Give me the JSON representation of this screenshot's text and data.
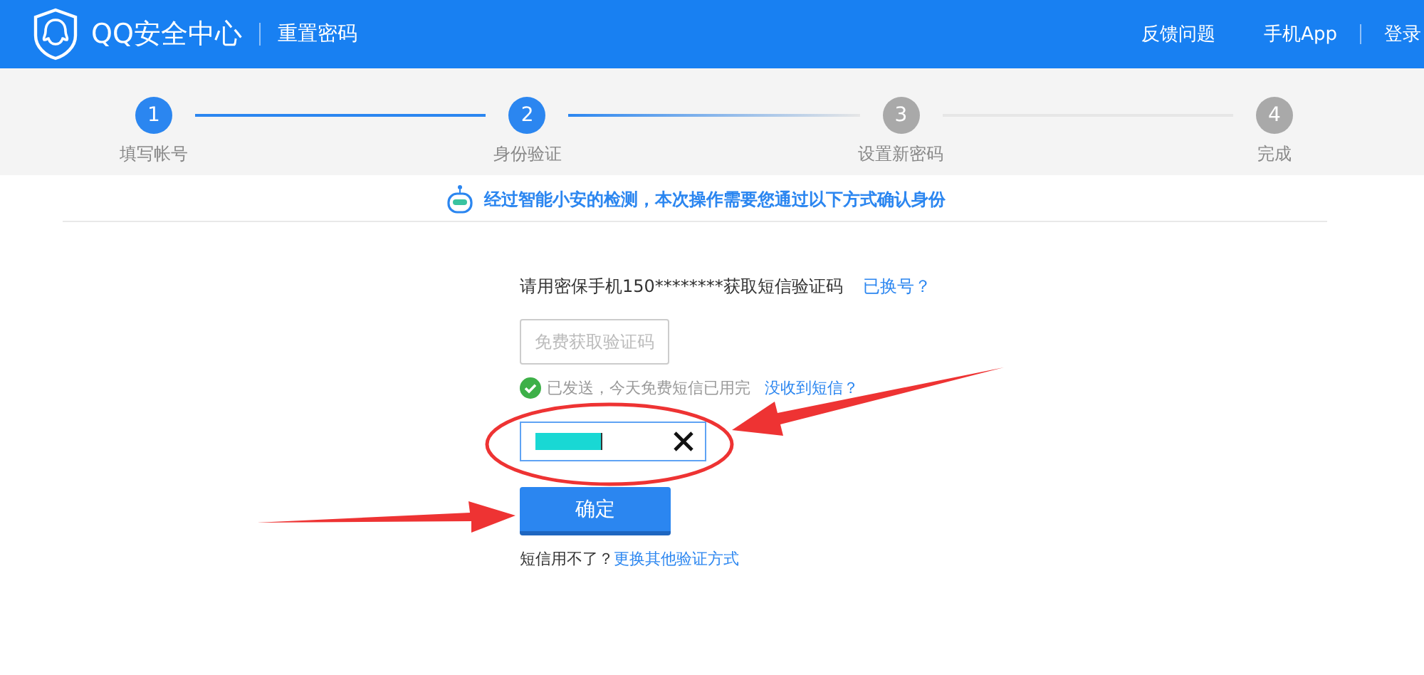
{
  "header": {
    "title": "QQ安全中心",
    "subtitle": "重置密码",
    "links": [
      "反馈问题",
      "手机App",
      "登录"
    ]
  },
  "steps": [
    {
      "number": "1",
      "label": "填写帐号",
      "active": true
    },
    {
      "number": "2",
      "label": "身份验证",
      "active": true
    },
    {
      "number": "3",
      "label": "设置新密码",
      "active": false
    },
    {
      "number": "4",
      "label": "完成",
      "active": false
    }
  ],
  "notice": "经过智能小安的检测，本次操作需要您通过以下方式确认身份",
  "form": {
    "prompt": "请用密保手机150********获取短信验证码",
    "change_link": "已换号？",
    "code_button": "免费获取验证码",
    "status": "已发送，今天免费短信已用完",
    "not_received_link": "没收到短信？",
    "confirm_button": "确定",
    "alt_text": "短信用不了？",
    "alt_link": "更换其他验证方式"
  }
}
